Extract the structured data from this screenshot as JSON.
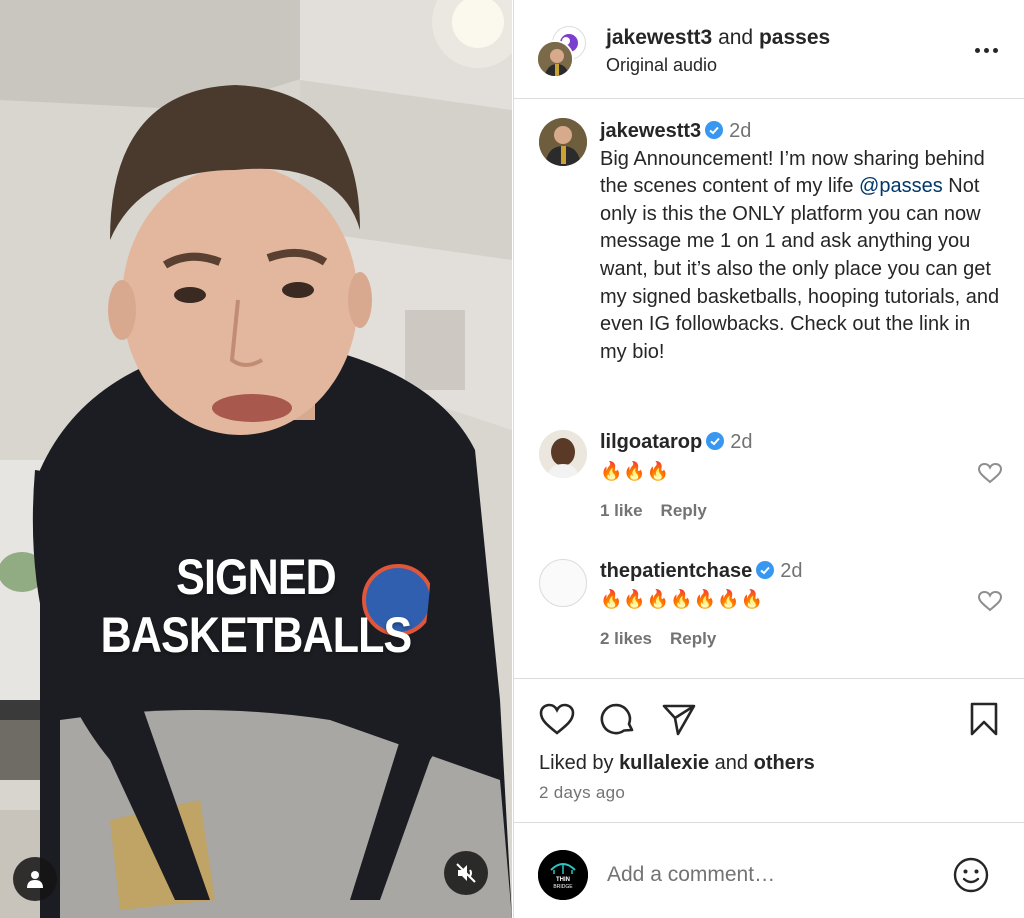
{
  "media": {
    "overlay_text": "SIGNED BASKETBALLS"
  },
  "header": {
    "author": "jakewestt3",
    "connector": " and ",
    "collaborator": "passes",
    "audio": "Original audio"
  },
  "post": {
    "username": "jakewestt3",
    "time": "2d",
    "caption_before": "Big Announcement! I’m now sharing behind the scenes content of my life ",
    "mention": "@passes",
    "caption_after": " Not only is this the ONLY platform you can now message me 1 on 1 and ask anything you want, but it’s also the only place you can get my signed basketballs, hooping tutorials, and even IG followbacks. Check out the link in my bio!"
  },
  "comments": [
    {
      "username": "lilgoatarop",
      "time": "2d",
      "text": "🔥🔥🔥",
      "likes": "1 like",
      "reply": "Reply"
    },
    {
      "username": "thepatientchase",
      "time": "2d",
      "text": "🔥🔥🔥🔥🔥🔥🔥",
      "likes": "2 likes",
      "reply": "Reply"
    }
  ],
  "engagement": {
    "liked_prefix": "Liked by ",
    "liked_user": "kullalexie",
    "liked_mid": " and ",
    "liked_suffix": "others",
    "posted": "2 days ago"
  },
  "comment_box": {
    "placeholder": "Add a comment…",
    "avatar_text_1": "THIN",
    "avatar_text_2": "BRIDGE"
  },
  "colors": {
    "verified": "#3897f0",
    "mention": "#00376b",
    "muted_text": "#737373",
    "divider": "#dbdbdb"
  },
  "icons": [
    "user-icon",
    "muted-speaker-icon",
    "more-icon",
    "verified-badge-icon",
    "heart-icon",
    "comment-icon",
    "share-icon",
    "bookmark-icon",
    "emoji-icon"
  ]
}
